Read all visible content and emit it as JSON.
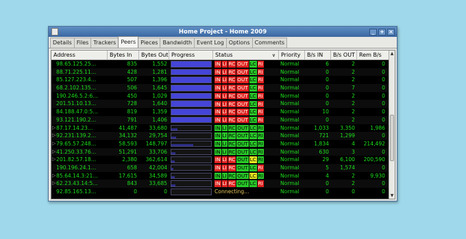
{
  "window": {
    "title": "Home Project - Home 2009",
    "controls": [
      "_",
      "+",
      "×"
    ]
  },
  "tabs": [
    "Details",
    "Files",
    "Trackers",
    "Peers",
    "Pieces",
    "Bandwidth",
    "Event Log",
    "Options",
    "Comments"
  ],
  "active_tab": "Peers",
  "columns": {
    "address": "Address",
    "bytes_in": "Bytes In",
    "bytes_out": "Bytes Out",
    "progress": "Progress",
    "status": "Status",
    "priority": "Priority",
    "bs_in": "B/s IN",
    "bs_out": "B/s OUT",
    "rem_bs": "Rem B/s"
  },
  "sort_indicator": "∨",
  "flag_labels": [
    "IN",
    "LI",
    "RC",
    "OUT",
    "LC",
    "RI"
  ],
  "rows": [
    {
      "address": "98.65.125.25…",
      "bytes_in": "835",
      "bytes_out": "1,552",
      "progress": 1.0,
      "flags": [
        "red",
        "red",
        "red",
        "red",
        "green",
        "red"
      ],
      "priority": "Normal",
      "bs_in": "6",
      "bs_out": "2",
      "rem": "0",
      "expandable": false
    },
    {
      "address": "88.71.225.11…",
      "bytes_in": "428",
      "bytes_out": "1,281",
      "progress": 1.0,
      "flags": [
        "red",
        "red",
        "red",
        "red",
        "green",
        "red"
      ],
      "priority": "Normal",
      "bs_in": "0",
      "bs_out": "2",
      "rem": "0",
      "expandable": false
    },
    {
      "address": "85.127.223.4…",
      "bytes_in": "507",
      "bytes_out": "1,396",
      "progress": 1.0,
      "flags": [
        "red",
        "red",
        "red",
        "red",
        "green",
        "red"
      ],
      "priority": "Normal",
      "bs_in": "0",
      "bs_out": "2",
      "rem": "0",
      "expandable": false
    },
    {
      "address": "68.2.102.135…",
      "bytes_in": "506",
      "bytes_out": "1,645",
      "progress": 1.0,
      "flags": [
        "red",
        "red",
        "red",
        "red",
        "green",
        "red"
      ],
      "priority": "Normal",
      "bs_in": "0",
      "bs_out": "7",
      "rem": "0",
      "expandable": false
    },
    {
      "address": "190.246.5.2:6…",
      "bytes_in": "450",
      "bytes_out": "1,029",
      "progress": 1.0,
      "flags": [
        "red",
        "red",
        "red",
        "red",
        "green",
        "red"
      ],
      "priority": "Normal",
      "bs_in": "0",
      "bs_out": "2",
      "rem": "0",
      "expandable": false
    },
    {
      "address": "201.51.10.13…",
      "bytes_in": "728",
      "bytes_out": "1,640",
      "progress": 1.0,
      "flags": [
        "red",
        "red",
        "red",
        "red",
        "green",
        "red"
      ],
      "priority": "Normal",
      "bs_in": "0",
      "bs_out": "2",
      "rem": "0",
      "expandable": false
    },
    {
      "address": "84.188.47.0:5…",
      "bytes_in": "819",
      "bytes_out": "1,359",
      "progress": 1.0,
      "flags": [
        "red",
        "red",
        "red",
        "red",
        "green",
        "red"
      ],
      "priority": "Normal",
      "bs_in": "10",
      "bs_out": "2",
      "rem": "0",
      "expandable": false
    },
    {
      "address": "93.121.190.2…",
      "bytes_in": "791",
      "bytes_out": "1,406",
      "progress": 1.0,
      "flags": [
        "red",
        "red",
        "red",
        "red",
        "green",
        "red"
      ],
      "priority": "Normal",
      "bs_in": "0",
      "bs_out": "2",
      "rem": "0",
      "expandable": false
    },
    {
      "address": "87.17.14.23…",
      "bytes_in": "41,487",
      "bytes_out": "33,680",
      "progress": 0.15,
      "flags": [
        "green",
        "green",
        "green",
        "green",
        "green",
        "green"
      ],
      "priority": "Normal",
      "bs_in": "1,033",
      "bs_out": "3,350",
      "rem": "1,986",
      "expandable": true
    },
    {
      "address": "92.231.139.2…",
      "bytes_in": "34,132",
      "bytes_out": "29,754",
      "progress": 0.12,
      "flags": [
        "green",
        "green",
        "green",
        "green",
        "green",
        "green"
      ],
      "priority": "Normal",
      "bs_in": "721",
      "bs_out": "1,299",
      "rem": "0",
      "expandable": true
    },
    {
      "address": "79.65.57.248…",
      "bytes_in": "58,593",
      "bytes_out": "148,797",
      "progress": 0.55,
      "flags": [
        "green",
        "green",
        "green",
        "green",
        "green",
        "green"
      ],
      "priority": "Normal",
      "bs_in": "1,834",
      "bs_out": "4",
      "rem": "214,492",
      "expandable": true
    },
    {
      "address": "41.250.33.76…",
      "bytes_in": "51,291",
      "bytes_out": "33,706",
      "progress": 0.1,
      "flags": [
        "green",
        "green",
        "green",
        "green",
        "green",
        "green"
      ],
      "priority": "Normal",
      "bs_in": "630",
      "bs_out": "3",
      "rem": "0",
      "expandable": true
    },
    {
      "address": "201.82.57.18…",
      "bytes_in": "2,380",
      "bytes_out": "362,614",
      "progress": 0.08,
      "flags": [
        "red",
        "red",
        "red",
        "green",
        "yellow",
        "green"
      ],
      "priority": "Normal",
      "bs_in": "29",
      "bs_out": "6,100",
      "rem": "200,590",
      "expandable": true
    },
    {
      "address": "190.196.24.1…",
      "bytes_in": "658",
      "bytes_out": "42,004",
      "progress": 0.05,
      "flags": [
        "red",
        "red",
        "red",
        "green",
        "green",
        "red"
      ],
      "priority": "Normal",
      "bs_in": "5",
      "bs_out": "1,574",
      "rem": "0",
      "expandable": false
    },
    {
      "address": "85.64.14.3:21…",
      "bytes_in": "17,615",
      "bytes_out": "34,589",
      "progress": 0.08,
      "flags": [
        "green",
        "green",
        "green",
        "green",
        "yellow",
        "green"
      ],
      "priority": "Normal",
      "bs_in": "4",
      "bs_out": "2",
      "rem": "9,930",
      "expandable": true
    },
    {
      "address": "62.23.43.14:5…",
      "bytes_in": "843",
      "bytes_out": "33,685",
      "progress": 0.1,
      "flags": [
        "red",
        "red",
        "red",
        "green",
        "green",
        "red"
      ],
      "priority": "Normal",
      "bs_in": "0",
      "bs_out": "2",
      "rem": "0",
      "expandable": true
    },
    {
      "address": "92.85.165.13…",
      "bytes_in": "0",
      "bytes_out": "0",
      "progress": 0.0,
      "status_text": "Connecting...",
      "priority": "Normal",
      "bs_in": "0",
      "bs_out": "0",
      "rem": "0",
      "expandable": false
    }
  ]
}
